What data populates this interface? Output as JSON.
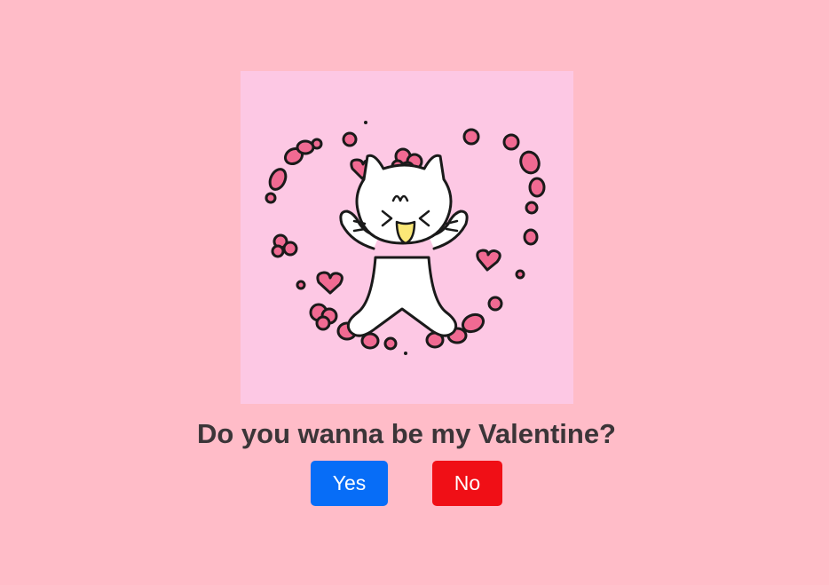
{
  "page": {
    "question": "Do you wanna be my Valentine?"
  },
  "buttons": {
    "yes_label": "Yes",
    "no_label": "No"
  },
  "illustration": {
    "icon": "cat-with-hearts-icon",
    "description_colors": {
      "frame_background": "#fdc8e4",
      "heart_color": "#f06a92",
      "cat_body": "#ffffff",
      "cat_mouth": "#fbe877"
    }
  },
  "colors": {
    "page_background": "#ffbcc8",
    "yes_button": "#076df7",
    "no_button": "#f00f16",
    "text": "#3b3538"
  }
}
